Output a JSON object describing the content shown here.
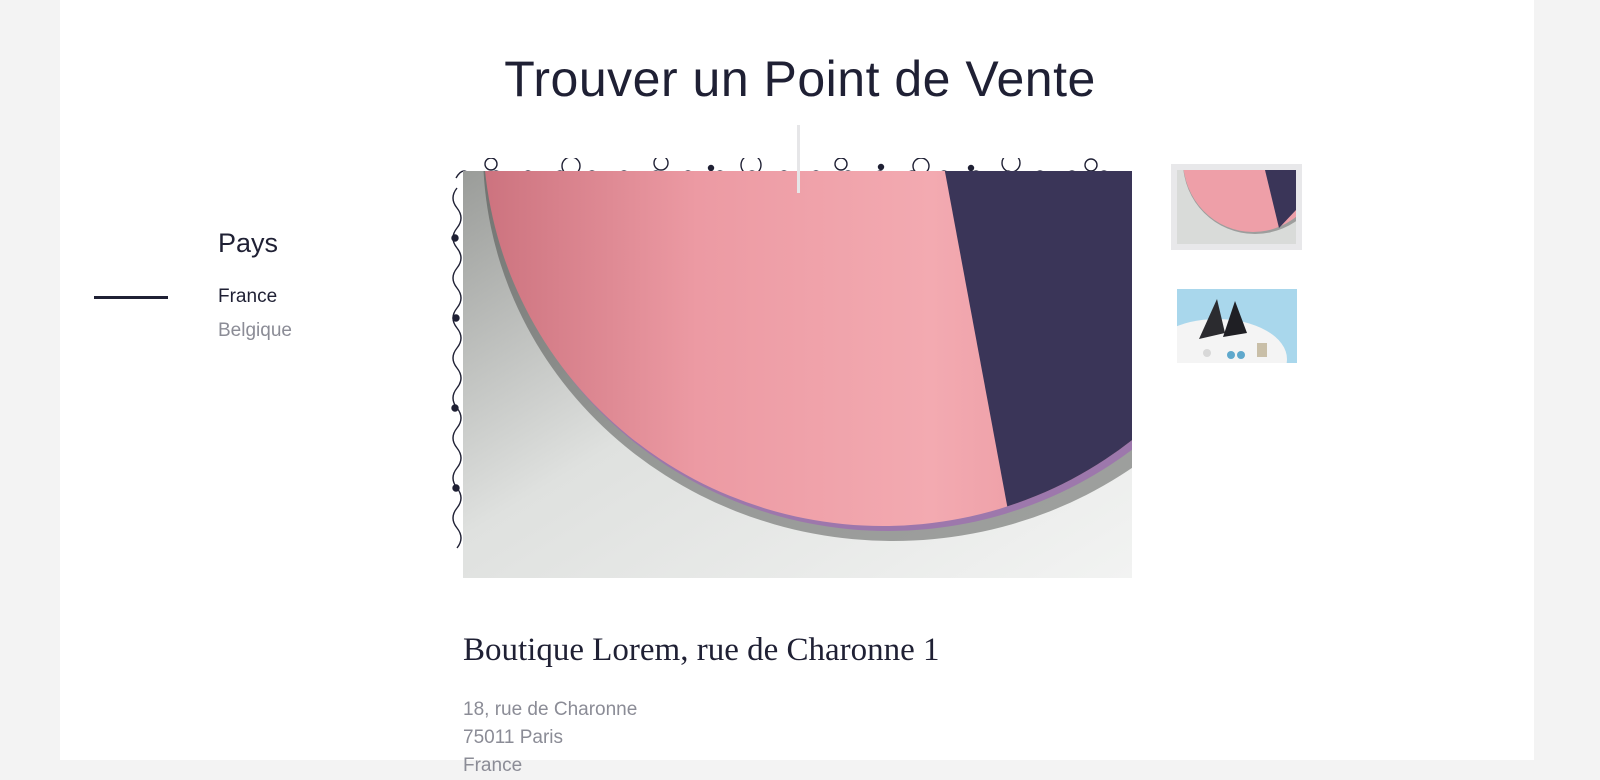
{
  "page": {
    "title": "Trouver un Point de Vente"
  },
  "sidebar": {
    "heading": "Pays",
    "countries": [
      "France",
      "Belgique"
    ],
    "selected": "France"
  },
  "gallery": {
    "main_image": "pink-circle-mirror-photo",
    "thumbnails": [
      "pink-circle-thumbnail",
      "geometric-objects-thumbnail"
    ]
  },
  "store": {
    "name": "Boutique Lorem, rue de Charonne 1",
    "address": [
      "18, rue de Charonne",
      "75011 Paris",
      "France"
    ]
  },
  "colors": {
    "background": "#f3f3f3",
    "panel": "#ffffff",
    "text_dark": "#1f2034",
    "text_muted": "#8b8c96"
  }
}
